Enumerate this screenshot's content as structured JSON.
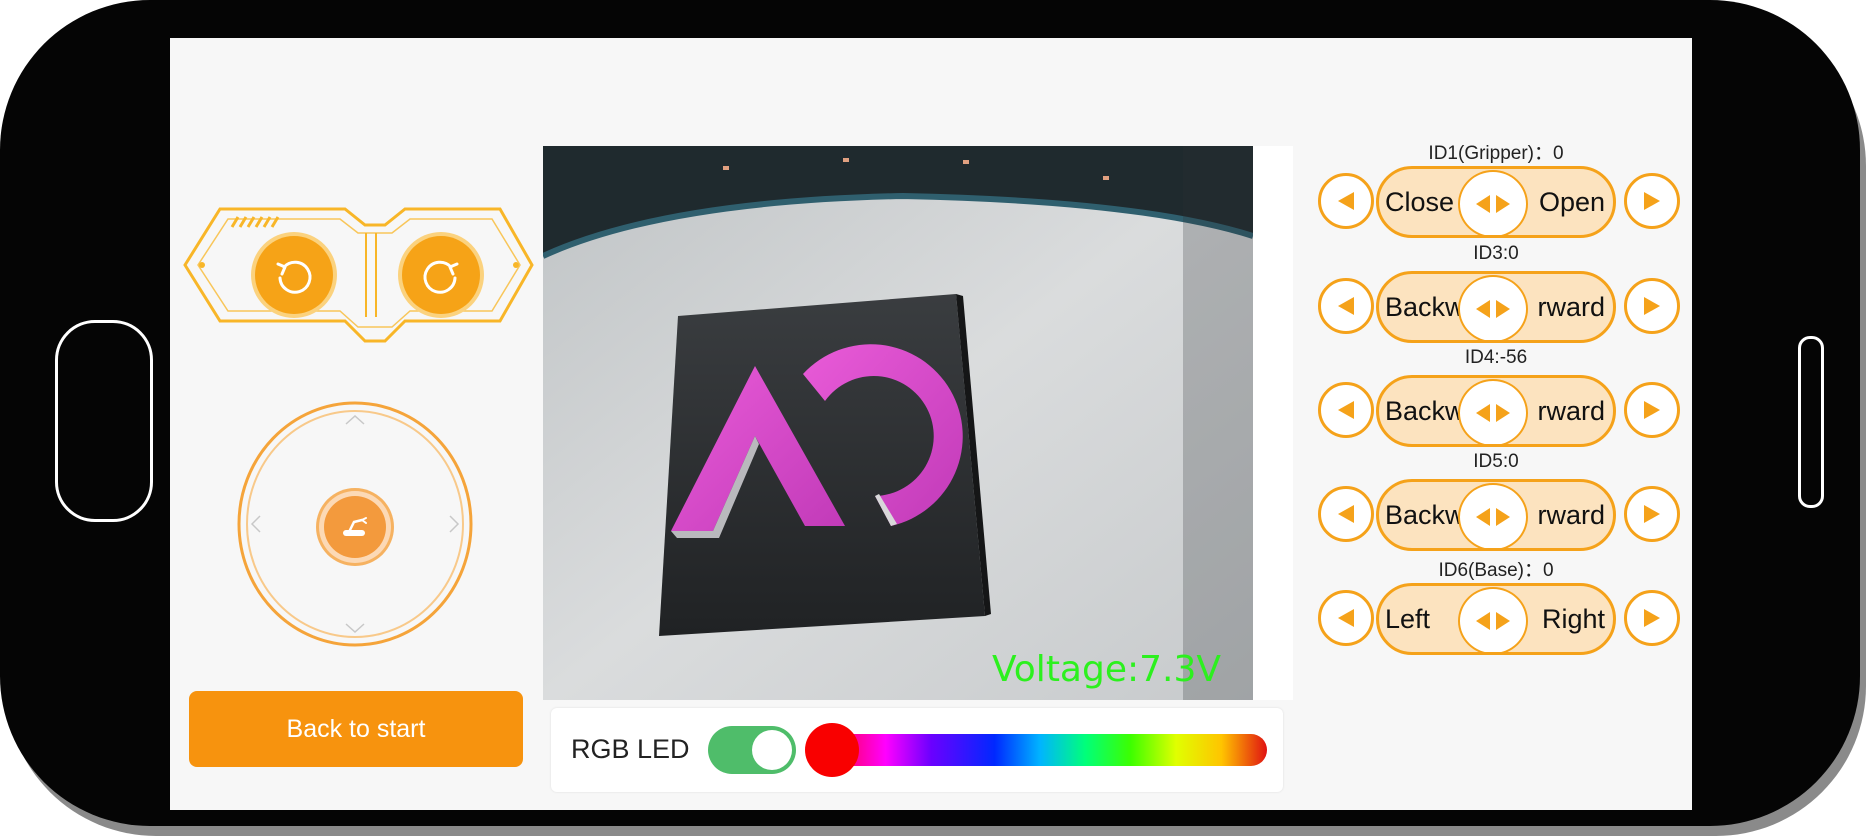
{
  "colors": {
    "accent": "#f7930e",
    "pill_fill": "#fce3bf",
    "toggle_on": "#4fbd6a",
    "voltage_text": "#2cf01e"
  },
  "controls": {
    "rotate_left_icon": "rotate-counterclockwise-icon",
    "rotate_right_icon": "rotate-clockwise-icon",
    "joystick_icon": "robot-arm-icon",
    "back_button_label": "Back to start"
  },
  "camera": {
    "voltage_label": "Voltage:7.3V"
  },
  "rgb_led": {
    "label": "RGB LED",
    "enabled": true,
    "hue": 0
  },
  "servos": [
    {
      "label": "ID1(Gripper)：0",
      "left_text": "Close",
      "right_text": "Open"
    },
    {
      "label": "ID3:0",
      "left_text": "Backw",
      "right_text": "rward"
    },
    {
      "label": "ID4:-56",
      "left_text": "Backw",
      "right_text": "rward"
    },
    {
      "label": "ID5:0",
      "left_text": "Backw",
      "right_text": "rward"
    },
    {
      "label": "ID6(Base)：0",
      "left_text": "Left",
      "right_text": "Right"
    }
  ]
}
